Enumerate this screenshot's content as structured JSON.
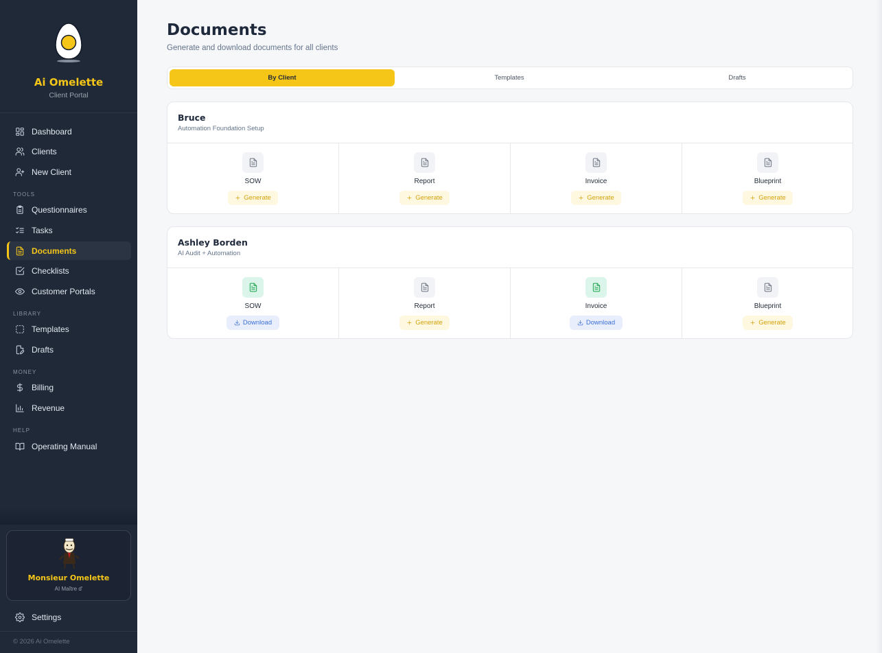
{
  "sidebar": {
    "brand_name": "Ai Omelette",
    "brand_sub": "Client Portal",
    "items": {
      "dashboard": "Dashboard",
      "clients": "Clients",
      "new_client": "New Client",
      "questionnaires": "Questionnaires",
      "tasks": "Tasks",
      "documents": "Documents",
      "checklists": "Checklists",
      "customer_portals": "Customer Portals",
      "templates": "Templates",
      "drafts": "Drafts",
      "billing": "Billing",
      "revenue": "Revenue",
      "operating_manual": "Operating Manual",
      "settings": "Settings"
    },
    "sections": {
      "tools": "TOOLS",
      "library": "LIBRARY",
      "money": "MONEY",
      "help": "HELP"
    },
    "profile": {
      "name": "Monsieur Omelette",
      "role": "AI Maître d'"
    },
    "copyright": "© 2026 Ai Omelette",
    "accent_color": "#f5c518"
  },
  "main": {
    "title": "Documents",
    "subtitle": "Generate and download documents for all clients",
    "tabs": [
      "By Client",
      "Templates",
      "Drafts"
    ],
    "active_tab": "By Client",
    "clients": [
      {
        "name": "Bruce",
        "project": "Automation Foundation Setup",
        "docs": [
          {
            "label": "SOW",
            "action": "Generate"
          },
          {
            "label": "Report",
            "action": "Generate"
          },
          {
            "label": "Invoice",
            "action": "Generate"
          },
          {
            "label": "Blueprint",
            "action": "Generate"
          }
        ]
      },
      {
        "name": "Ashley Borden",
        "project": "AI Audit + Automation",
        "docs": [
          {
            "label": "SOW",
            "action": "Download"
          },
          {
            "label": "Report",
            "action": "Generate"
          },
          {
            "label": "Invoice",
            "action": "Download"
          },
          {
            "label": "Blueprint",
            "action": "Generate"
          }
        ]
      }
    ]
  }
}
